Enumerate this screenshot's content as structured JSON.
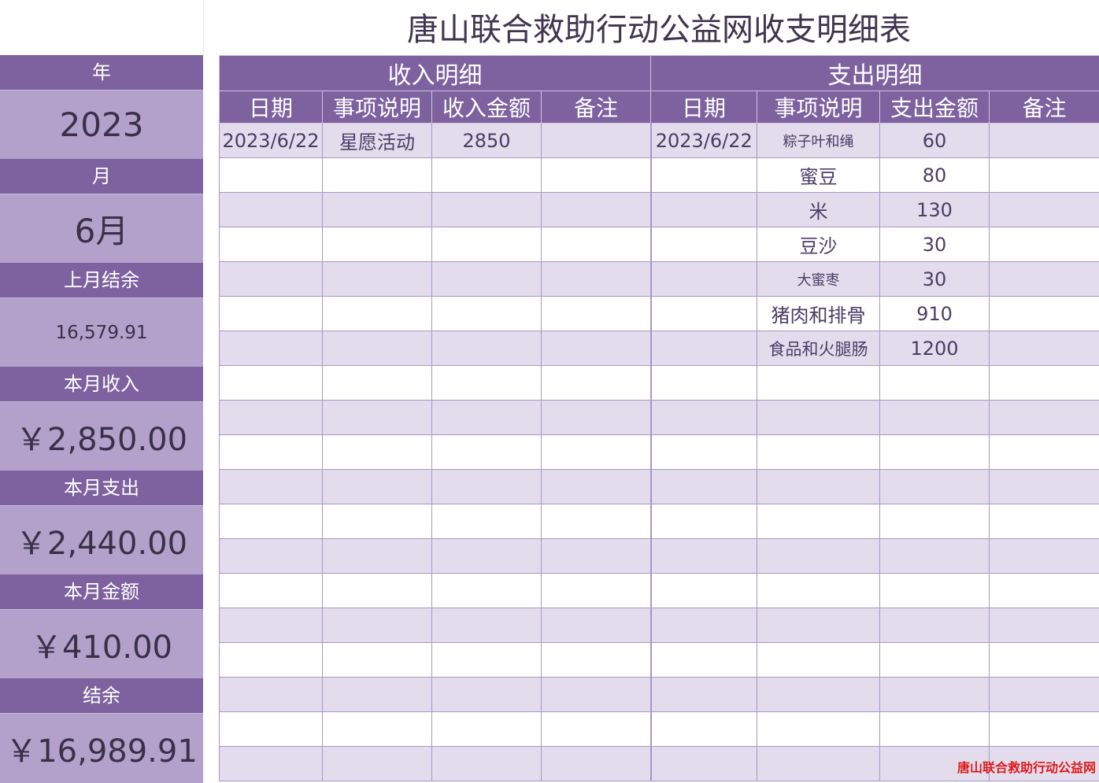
{
  "title": "唐山联合救助行动公益网收支明细表",
  "sidebar": {
    "year_label": "年",
    "year_value": "2023",
    "month_label": "月",
    "month_value": "6月",
    "last_balance_label": "上月结余",
    "last_balance_value": "16,579.91",
    "income_label": "本月收入",
    "income_value": "￥2,850.00",
    "expense_label": "本月支出",
    "expense_value": "￥2,440.00",
    "amount_label": "本月金额",
    "amount_value": "￥410.00",
    "balance_label": "结余",
    "balance_value": "￥16,989.91"
  },
  "income": {
    "section_title": "收入明细",
    "headers": [
      "日期",
      "事项说明",
      "收入金额",
      "备注"
    ],
    "rows": [
      [
        "2023/6/22",
        "星愿活动",
        "2850",
        ""
      ]
    ]
  },
  "expense": {
    "section_title": "支出明细",
    "headers": [
      "日期",
      "事项说明",
      "支出金额",
      "备注"
    ],
    "rows": [
      [
        "2023/6/22",
        "粽子叶和绳",
        "60",
        ""
      ],
      [
        "",
        "蜜豆",
        "80",
        ""
      ],
      [
        "",
        "米",
        "130",
        ""
      ],
      [
        "",
        "豆沙",
        "30",
        ""
      ],
      [
        "",
        "大蜜枣",
        "30",
        ""
      ],
      [
        "",
        "猪肉和排骨",
        "910",
        ""
      ],
      [
        "",
        "食品和火腿肠",
        "1200",
        ""
      ]
    ]
  },
  "watermark": "唐山联合救助行动公益网",
  "colors": {
    "header_purple": "#7e619f",
    "sidebar_value_bg": "#b3a1cc",
    "row_stripe": "#e3dcec",
    "watermark_red": "#e0191a"
  }
}
